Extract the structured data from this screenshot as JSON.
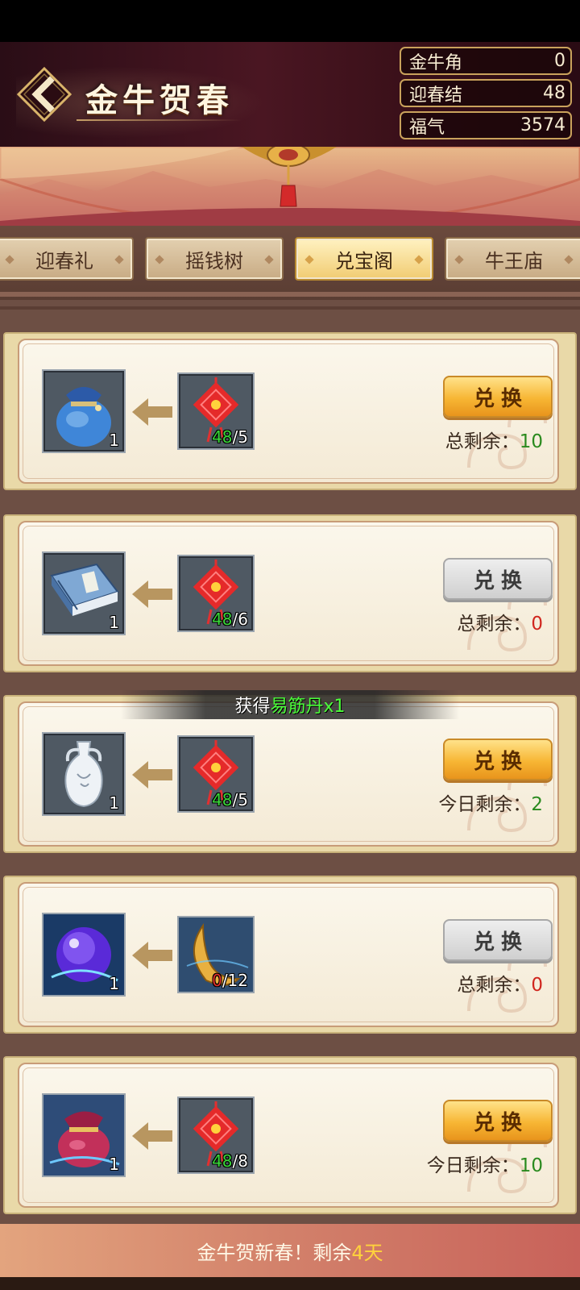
{
  "header": {
    "title": "金牛贺春",
    "resources": [
      {
        "name": "金牛角",
        "value": "0"
      },
      {
        "name": "迎春结",
        "value": "48"
      },
      {
        "name": "福气",
        "value": "3574"
      }
    ]
  },
  "tabs": [
    {
      "label": "迎春礼",
      "active": false
    },
    {
      "label": "摇钱树",
      "active": false
    },
    {
      "label": "兑宝阁",
      "active": true
    },
    {
      "label": "牛王庙",
      "active": false
    }
  ],
  "exchange_items": [
    {
      "reward_icon": "blue-pouch-icon",
      "reward_qty": "1",
      "cost_icon": "chinese-knot-icon",
      "cost_have": "48",
      "cost_need": "/5",
      "button": "兑换",
      "enabled": true,
      "remain_label": "总剩余：",
      "remain_value": "10"
    },
    {
      "reward_icon": "book-icon",
      "reward_qty": "1",
      "cost_icon": "chinese-knot-icon",
      "cost_have": "48",
      "cost_need": "/6",
      "button": "兑换",
      "enabled": false,
      "remain_label": "总剩余：",
      "remain_value": "0"
    },
    {
      "reward_icon": "porcelain-vase-icon",
      "reward_qty": "1",
      "cost_icon": "chinese-knot-icon",
      "cost_have": "48",
      "cost_need": "/5",
      "button": "兑换",
      "enabled": true,
      "remain_label": "今日剩余：",
      "remain_value": "2"
    },
    {
      "reward_icon": "purple-orb-icon",
      "reward_qty": "1",
      "cost_icon": "golden-horn-icon",
      "cost_have": "0",
      "cost_need": "/12",
      "button": "兑换",
      "enabled": false,
      "remain_label": "总剩余：",
      "remain_value": "0"
    },
    {
      "reward_icon": "red-pouch-icon",
      "reward_qty": "1",
      "cost_icon": "chinese-knot-icon",
      "cost_have": "48",
      "cost_need": "/8",
      "button": "兑换",
      "enabled": true,
      "remain_label": "今日剩余：",
      "remain_value": "10"
    }
  ],
  "toast": {
    "prefix": "获得",
    "item": "易筋丹x1"
  },
  "footer": {
    "text": "金牛贺新春！剩余",
    "days": "4天"
  }
}
